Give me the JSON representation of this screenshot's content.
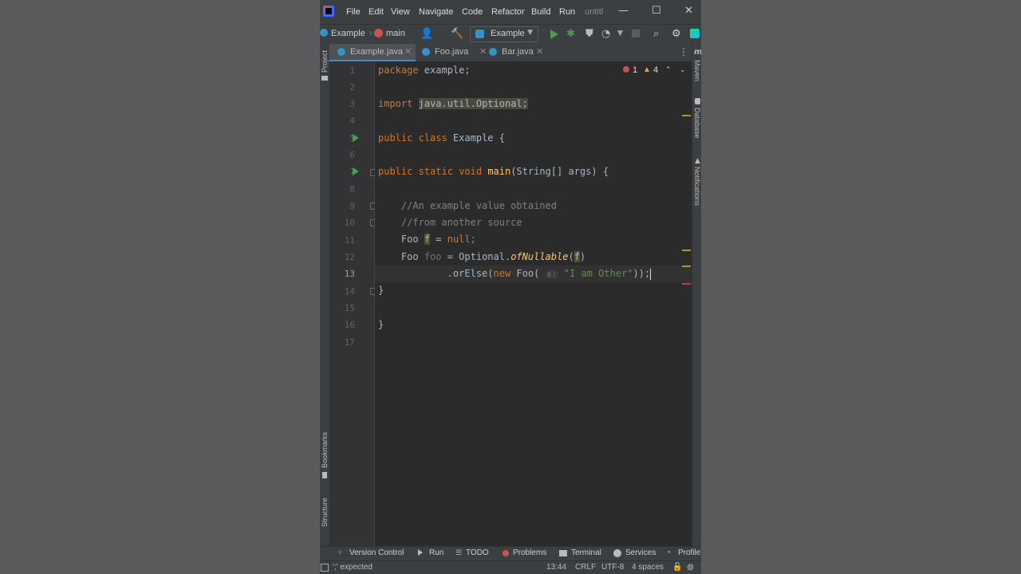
{
  "menu": {
    "items": [
      "File",
      "Edit",
      "View",
      "Navigate",
      "Code",
      "Refactor",
      "Build",
      "Run"
    ],
    "window_title": "untitl",
    "minimize": "—",
    "maximize": "☐",
    "close": "✕"
  },
  "nav": {
    "project": "Example",
    "branch": "main",
    "run_config": "Example"
  },
  "tabs": [
    {
      "label": "Example.java",
      "active": true
    },
    {
      "label": "Foo.java",
      "active": false
    },
    {
      "label": "Bar.java",
      "active": false
    }
  ],
  "inspections": {
    "errors": "1",
    "warnings": "4"
  },
  "side_left": {
    "project": "Project",
    "bookmarks": "Bookmarks",
    "structure": "Structure"
  },
  "side_right": {
    "maven": "Maven",
    "database": "Database",
    "notifications": "Notifications"
  },
  "editor": {
    "line_numbers": [
      "1",
      "2",
      "3",
      "4",
      "5",
      "6",
      "7",
      "8",
      "9",
      "10",
      "11",
      "12",
      "13",
      "14",
      "15",
      "16",
      "17"
    ],
    "current_line": "13",
    "l1_kw": "package",
    "l1_rest": " example;",
    "l3_kw": "import",
    "l3_pkg": "java.util.Optional;",
    "l5_public": "public",
    "l5_class": "class",
    "l5_name": "Example {",
    "l7_public": "public",
    "l7_static": "static",
    "l7_void": "void",
    "l7_fn": "main",
    "l7_rest": "(String[] args) {",
    "l9": "//An example value obtained",
    "l10": "//from another source",
    "l11_type": "Foo ",
    "l11_var": "f",
    "l11_eq": " = ",
    "l11_null": "null",
    "l11_end": ";",
    "l12_type": "Foo ",
    "l12_var": "foo",
    "l12_eq": " = Optional.",
    "l12_method": "ofNullable",
    "l12_paren": "(",
    "l12_arg": "f",
    "l12_close": ")",
    "l13_call": ".orElse(",
    "l13_new": "new",
    "l13_foo": " Foo(",
    "l13_hint": "s:",
    "l13_str": "\"I am Other\"",
    "l13_end": "));",
    "l14": "}",
    "l16": "}"
  },
  "toolwindows": [
    "Version Control",
    "Run",
    "TODO",
    "Problems",
    "Terminal",
    "Services",
    "Profiler"
  ],
  "status": {
    "message": "';' expected",
    "position": "13:44",
    "line_sep": "CRLF",
    "encoding": "UTF-8",
    "indent": "4 spaces"
  }
}
